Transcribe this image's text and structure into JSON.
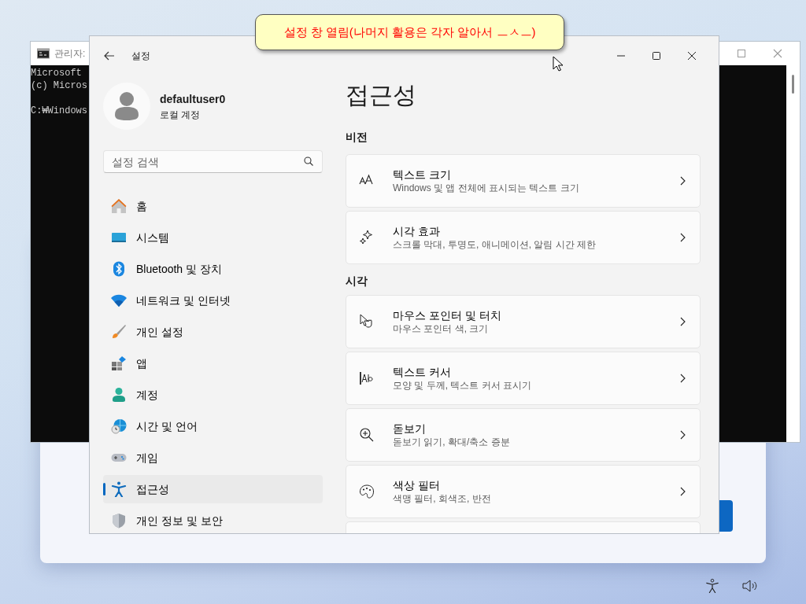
{
  "cmd_window": {
    "title": "관리자:",
    "paragraphs": [
      [
        "Microsoft",
        "(c) Micros"
      ],
      [
        "C:₩Windows"
      ]
    ]
  },
  "tooltip": {
    "text": "설정 창 열림(나머지 활용은 각자 알아서 ㅡㅅㅡ)"
  },
  "settings": {
    "title": "설정",
    "user": {
      "name": "defaultuser0",
      "account": "로컬 계정"
    },
    "search": {
      "placeholder": "설정 검색"
    },
    "nav": [
      {
        "kind": "home",
        "label": "홈",
        "selected": false
      },
      {
        "kind": "system",
        "label": "시스템",
        "selected": false
      },
      {
        "kind": "bluetooth",
        "label": "Bluetooth 및 장치",
        "selected": false
      },
      {
        "kind": "network",
        "label": "네트워크 및 인터넷",
        "selected": false
      },
      {
        "kind": "personalize",
        "label": "개인 설정",
        "selected": false
      },
      {
        "kind": "apps",
        "label": "앱",
        "selected": false
      },
      {
        "kind": "accounts",
        "label": "계정",
        "selected": false
      },
      {
        "kind": "time",
        "label": "시간 및 언어",
        "selected": false
      },
      {
        "kind": "gaming",
        "label": "게임",
        "selected": false
      },
      {
        "kind": "accessibility",
        "label": "접근성",
        "selected": true
      },
      {
        "kind": "privacy",
        "label": "개인 정보 및 보안",
        "selected": false
      }
    ],
    "page_title": "접근성",
    "sections": [
      {
        "heading": "비전",
        "items": [
          {
            "kind": "text-size",
            "title": "텍스트 크기",
            "subtitle": "Windows 및 앱 전체에 표시되는 텍스트 크기"
          },
          {
            "kind": "effects",
            "title": "시각 효과",
            "subtitle": "스크롤 막대, 투명도, 애니메이션, 알림 시간 제한"
          }
        ]
      },
      {
        "heading": "시각",
        "items": [
          {
            "kind": "pointer",
            "title": "마우스 포인터 및 터치",
            "subtitle": "마우스 포인터 색, 크기"
          },
          {
            "kind": "cursor",
            "title": "텍스트 커서",
            "subtitle": "모양 및 두께, 텍스트 커서 표시기"
          },
          {
            "kind": "magnifier",
            "title": "돋보기",
            "subtitle": "돋보기 읽기, 확대/축소 증분"
          },
          {
            "kind": "filters",
            "title": "색상 필터",
            "subtitle": "색맹 필터, 회색조, 반전"
          },
          {
            "kind": "blank"
          }
        ]
      }
    ]
  }
}
